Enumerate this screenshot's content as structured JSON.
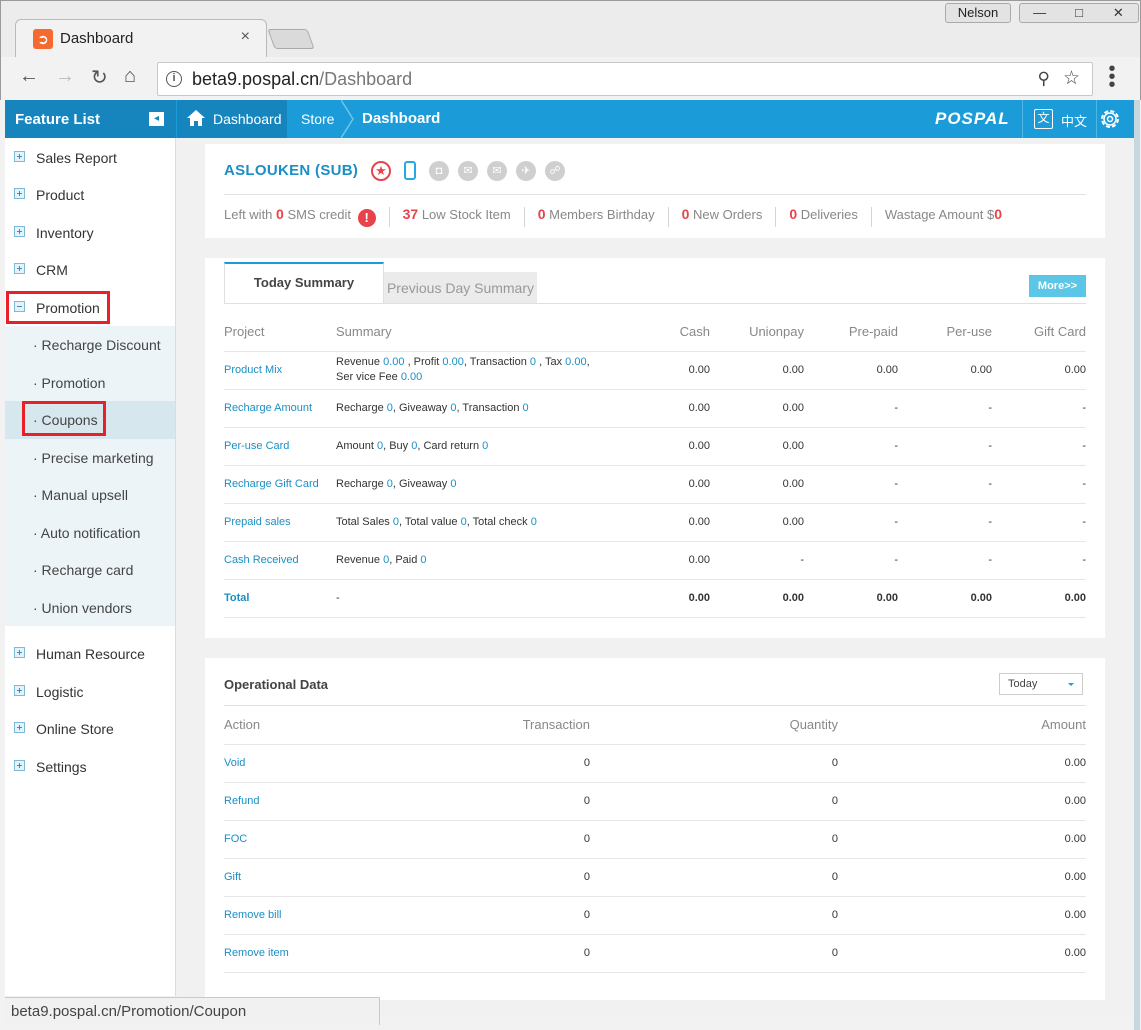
{
  "browser": {
    "tab_title": "Dashboard",
    "tab_close": "×",
    "profile_name": "Nelson",
    "window_buttons": [
      "—",
      "□",
      "✕"
    ],
    "url_host": "beta9.pospal.cn",
    "url_path": "/Dashboard",
    "status_url": "beta9.pospal.cn/Promotion/Coupon"
  },
  "header": {
    "feature_list": "Feature List",
    "crumb_home": "Dashboard",
    "crumb_store": "Store",
    "crumb_current": "Dashboard",
    "brand": "POSPAL",
    "lang_label": "中文",
    "lang_icon_glyph": "文"
  },
  "sidebar": {
    "items": [
      {
        "label": "Sales Report"
      },
      {
        "label": "Product"
      },
      {
        "label": "Inventory"
      },
      {
        "label": "CRM"
      },
      {
        "label": "Promotion"
      }
    ],
    "promotion_sub": [
      {
        "label": "· Recharge Discount"
      },
      {
        "label": "· Promotion"
      },
      {
        "label": "· Coupons"
      },
      {
        "label": "· Precise marketing"
      },
      {
        "label": "· Manual upsell"
      },
      {
        "label": "· Auto notification"
      },
      {
        "label": "· Recharge card"
      },
      {
        "label": "· Union vendors"
      }
    ],
    "items_after": [
      {
        "label": "Human Resource"
      },
      {
        "label": "Logistic"
      },
      {
        "label": "Online Store"
      },
      {
        "label": "Settings"
      }
    ]
  },
  "store": {
    "name": "ASLOUKEN (SUB)",
    "stats": {
      "sms_prefix": "Left with ",
      "sms_count": "0",
      "sms_suffix": " SMS credit",
      "low_stock_count": "37",
      "low_stock_label": " Low Stock Item",
      "birthday_count": "0",
      "birthday_label": " Members Birthday",
      "orders_count": "0",
      "orders_label": " New Orders",
      "deliveries_count": "0",
      "deliveries_label": " Deliveries",
      "wastage_label": "Wastage Amount $",
      "wastage_value": "0"
    }
  },
  "summary": {
    "tab_today": "Today Summary",
    "tab_previous": "Previous Day Summary",
    "more": "More>>",
    "columns": [
      "Project",
      "Summary",
      "Cash",
      "Unionpay",
      "Pre-paid",
      "Per-use",
      "Gift Card"
    ],
    "rows": [
      {
        "project": "Product Mix",
        "summary_html": "Revenue <span class='v'>0.00</span> , Profit <span class='v'>0.00</span>, Transaction <span class='v'>0</span> , Tax <span class='v'>0.00</span>, Ser vice Fee <span class='v'>0.00</span>",
        "cash": "0.00",
        "unionpay": "0.00",
        "prepaid": "0.00",
        "peruse": "0.00",
        "giftcard": "0.00"
      },
      {
        "project": "Recharge Amount",
        "summary_html": "Recharge <span class='v'>0</span>, Giveaway <span class='v'>0</span>, Transaction <span class='v'>0</span>",
        "cash": "0.00",
        "unionpay": "0.00",
        "prepaid": "-",
        "peruse": "-",
        "giftcard": "-"
      },
      {
        "project": "Per-use Card",
        "summary_html": "Amount <span class='v'>0</span>, Buy <span class='v'>0</span>, Card return <span class='v'>0</span>",
        "cash": "0.00",
        "unionpay": "0.00",
        "prepaid": "-",
        "peruse": "-",
        "giftcard": "-"
      },
      {
        "project": "Recharge Gift Card",
        "summary_html": "Recharge <span class='v'>0</span>, Giveaway <span class='v'>0</span>",
        "cash": "0.00",
        "unionpay": "0.00",
        "prepaid": "-",
        "peruse": "-",
        "giftcard": "-"
      },
      {
        "project": "Prepaid sales",
        "summary_html": "Total Sales <span class='v'>0</span>, Total value <span class='v'>0</span>, Total check <span class='v'>0</span>",
        "cash": "0.00",
        "unionpay": "0.00",
        "prepaid": "-",
        "peruse": "-",
        "giftcard": "-"
      },
      {
        "project": "Cash Received",
        "summary_html": "Revenue <span class='v'>0</span>, Paid <span class='v'>0</span>",
        "cash": "0.00",
        "unionpay": "-",
        "prepaid": "-",
        "peruse": "-",
        "giftcard": "-"
      }
    ],
    "total": {
      "project": "Total",
      "summary": "-",
      "cash": "0.00",
      "unionpay": "0.00",
      "prepaid": "0.00",
      "peruse": "0.00",
      "giftcard": "0.00"
    }
  },
  "ops": {
    "title": "Operational Data",
    "period": "Today",
    "columns": [
      "Action",
      "Transaction",
      "Quantity",
      "Amount"
    ],
    "rows": [
      {
        "action": "Void",
        "transaction": "0",
        "quantity": "0",
        "amount": "0.00"
      },
      {
        "action": "Refund",
        "transaction": "0",
        "quantity": "0",
        "amount": "0.00"
      },
      {
        "action": "FOC",
        "transaction": "0",
        "quantity": "0",
        "amount": "0.00"
      },
      {
        "action": "Gift",
        "transaction": "0",
        "quantity": "0",
        "amount": "0.00"
      },
      {
        "action": "Remove bill",
        "transaction": "0",
        "quantity": "0",
        "amount": "0.00"
      },
      {
        "action": "Remove item",
        "transaction": "0",
        "quantity": "0",
        "amount": "0.00"
      }
    ]
  },
  "colors": {
    "header_blue": "#1b9cd8",
    "header_dark": "#1785bd",
    "link_blue": "#1b8fc4",
    "alert_red": "#e8434b",
    "highlight_box": "#e8202a"
  }
}
